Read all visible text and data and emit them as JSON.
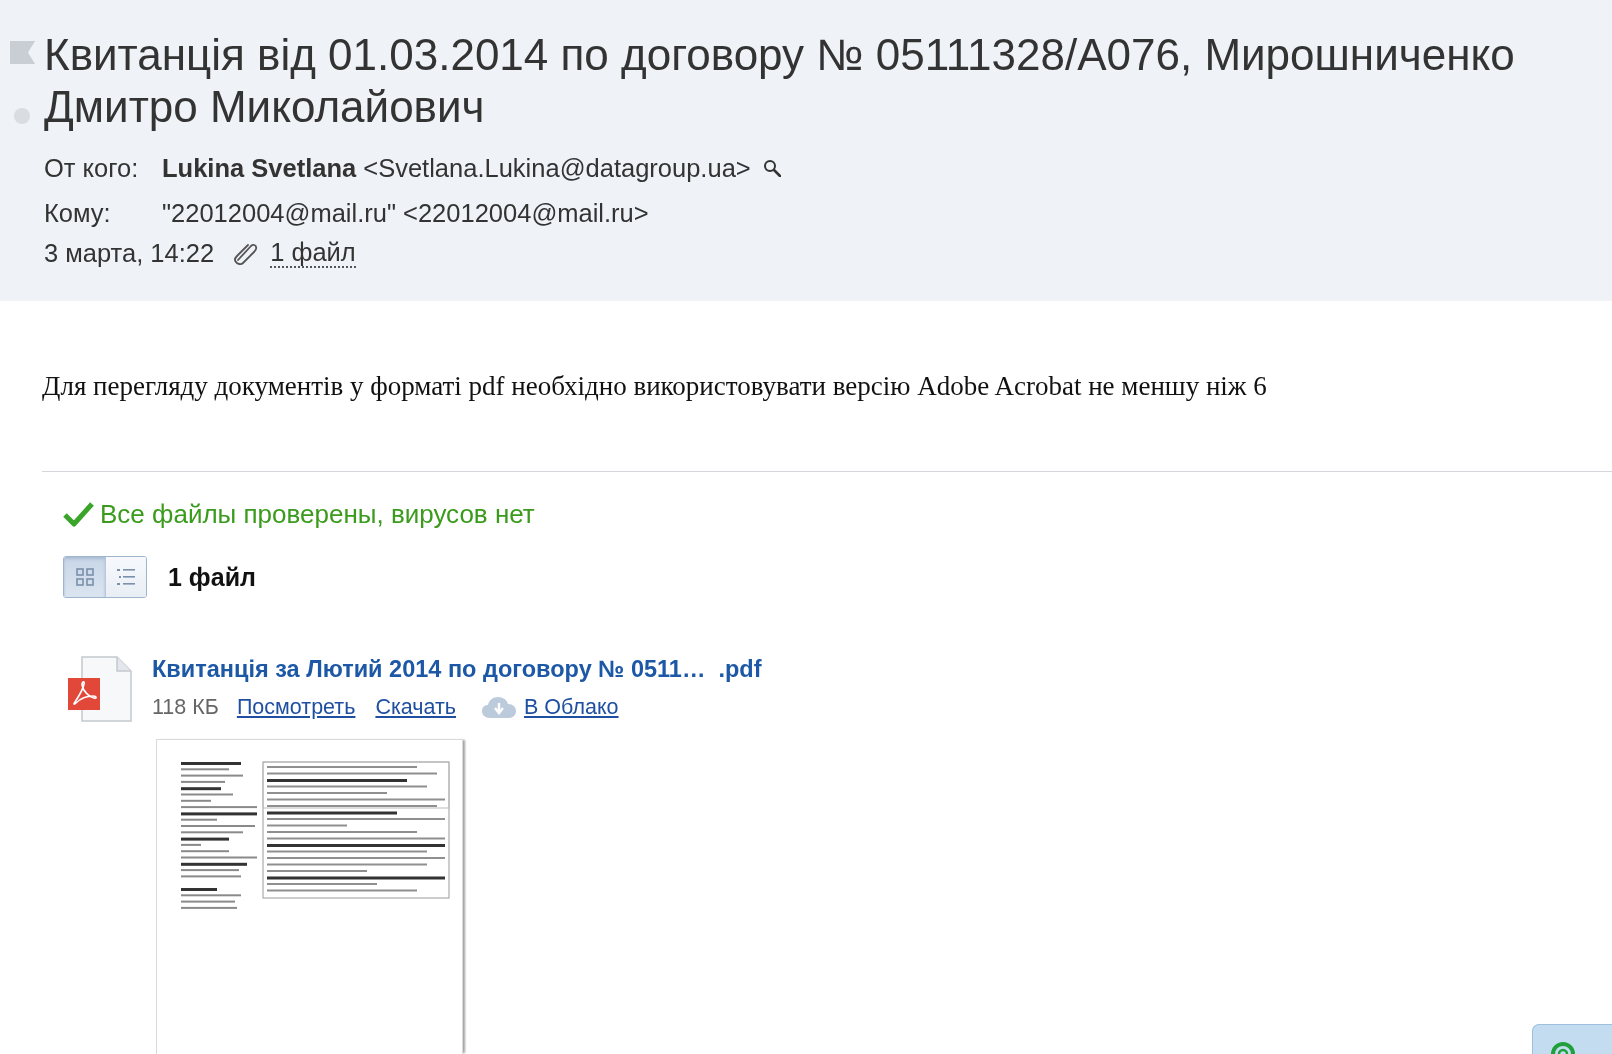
{
  "message": {
    "flagged": false,
    "unread": false
  },
  "header": {
    "title": "Квитанція від 01.03.2014 по договору № 05111328/A076, Мирошниченко Дмитро Миколайович",
    "from": {
      "label": "От кого:",
      "name": "Lukina Svetlana",
      "address": "<Svetlana.Lukina@datagroup.ua>"
    },
    "to": {
      "label": "Кому:",
      "value": "\"22012004@mail.ru\" <22012004@mail.ru>"
    },
    "date": "3 марта, 14:22",
    "attachments_link": "1 файл"
  },
  "body": {
    "text": "Для перегляду документів у форматі pdf необхідно використовувати версію Adobe Acrobat не меншу ніж 6"
  },
  "attachments": {
    "virus_check": {
      "passed": true,
      "text": "Все файлы проверены, вирусов нет"
    },
    "view_modes": [
      {
        "kind": "grid",
        "selected": true
      },
      {
        "kind": "list",
        "selected": false
      }
    ],
    "count": "1 файл",
    "files": [
      {
        "kind": "pdf",
        "name": "Квитанція за Лютий 2014 по договору № 0511…  .pdf",
        "size": "118 КБ",
        "actions": [
          {
            "kind": "view",
            "label": "Посмотреть"
          },
          {
            "kind": "download",
            "label": "Скачать"
          },
          {
            "kind": "cloud",
            "label": "В Облако"
          }
        ]
      }
    ]
  }
}
